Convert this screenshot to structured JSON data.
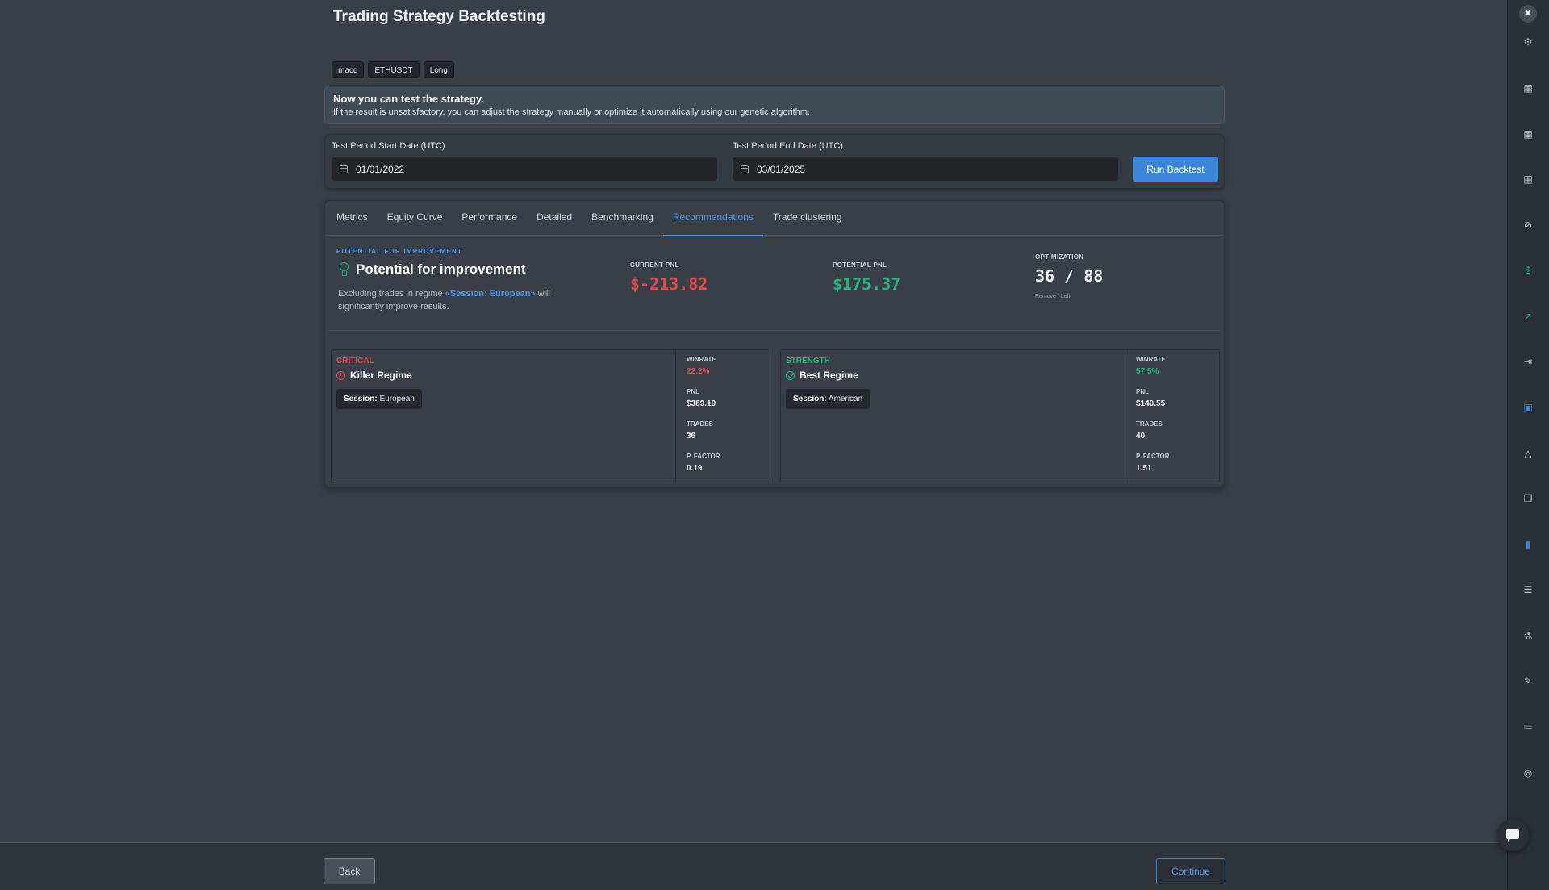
{
  "page_title": "Trading Strategy Backtesting",
  "tags": [
    "macd",
    "ETHUSDT",
    "Long"
  ],
  "banner": {
    "title": "Now you can test the strategy.",
    "text": "If the result is unsatisfactory, you can adjust the strategy manually or optimize it automatically using our genetic algorithm."
  },
  "dates": {
    "start_label": "Test Period Start Date (UTC)",
    "start_value": "01/01/2022",
    "end_label": "Test Period End Date (UTC)",
    "end_value": "03/01/2025",
    "run_label": "Run Backtest"
  },
  "tabs": [
    "Metrics",
    "Equity Curve",
    "Performance",
    "Detailed",
    "Benchmarking",
    "Recommendations",
    "Trade clustering"
  ],
  "active_tab": "Recommendations",
  "improvement": {
    "eyebrow": "POTENTIAL FOR IMPROVEMENT",
    "title": "Potential for improvement",
    "desc_prefix": "Excluding trades in regime ",
    "desc_highlight": "«Session: European»",
    "desc_suffix": " will significantly improve results.",
    "current_label": "CURRENT PNL",
    "current_value": "$-213.82",
    "potential_label": "POTENTIAL PNL",
    "potential_value": "$175.37",
    "optimization_label": "OPTIMIZATION",
    "optimization_value": "36 / 88",
    "optimization_sub": "Remove / Left"
  },
  "regimes": [
    {
      "kind": "CRITICAL",
      "name": "Killer Regime",
      "session_key": "Session:",
      "session_value": "European",
      "winrate_label": "WINRATE",
      "winrate": "22.2%",
      "pnl_label": "PNL",
      "pnl": "$389.19",
      "trades_label": "TRADES",
      "trades": "36",
      "pfactor_label": "P. FACTOR",
      "pfactor": "0.19"
    },
    {
      "kind": "STRENGTH",
      "name": "Best Regime",
      "session_key": "Session:",
      "session_value": "American",
      "winrate_label": "WINRATE",
      "winrate": "57.5%",
      "pnl_label": "PNL",
      "pnl": "$140.55",
      "trades_label": "TRADES",
      "trades": "40",
      "pfactor_label": "P. FACTOR",
      "pfactor": "1.51"
    }
  ],
  "footer": {
    "back_label": "Back",
    "continue_label": "Continue"
  },
  "sidebar_icons": [
    "gear-icon",
    "chart-icon",
    "chart-icon",
    "chart-icon",
    "ban-icon",
    "dollar-icon",
    "trend-icon",
    "logout-icon",
    "save-icon",
    "warning-icon",
    "copy-icon",
    "thermometer-icon",
    "list-icon",
    "flask-icon",
    "pencil-icon",
    "checklist-icon",
    "check-circle-icon"
  ],
  "colors": {
    "accent": "#3a87d9",
    "negative": "#e5484d",
    "positive": "#26b57a"
  }
}
